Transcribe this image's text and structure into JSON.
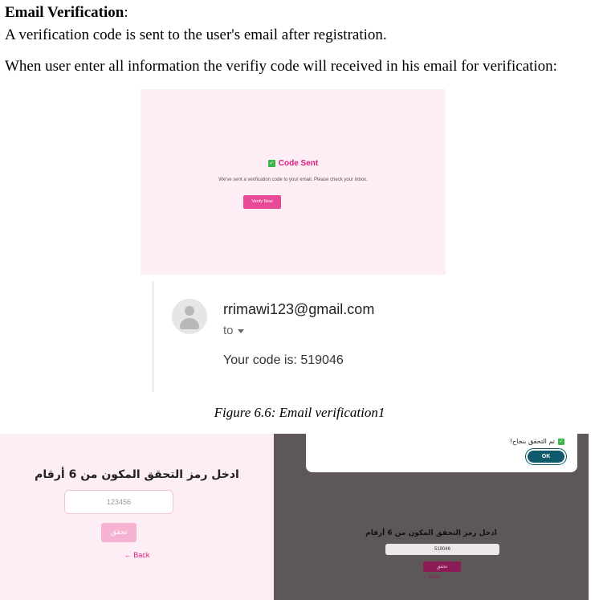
{
  "doc": {
    "heading": "Email Verification",
    "heading_suffix": ":",
    "paragraph1": "A verification code is sent to the user's email after registration.",
    "paragraph2": "When user enter all information the verifiy code will received in his email for verification:",
    "caption": "Figure 6.6: Email verification1"
  },
  "code_sent_screen": {
    "title": "Code Sent",
    "message": "We've sent a verification code to your email. Please check your inbox.",
    "button": "Verify Now",
    "icon": "check-box-icon",
    "accent": "#e0197c",
    "background": "#fdeef6"
  },
  "email_screen": {
    "sender": "rrimawi123@gmail.com",
    "to": "to",
    "body": "Your code is: 519046",
    "icon": "avatar-icon"
  },
  "enter_code_screen": {
    "title": "ادخل رمز التحقق المكون من 6 أرقام",
    "input_placeholder": "123456",
    "button": "تحقق",
    "back": "← Back"
  },
  "verified_screen": {
    "dialog_message": "تم التحقق بنجاح!",
    "ok_button": "OK",
    "title": "ادخل رمز التحقق المكون من 6 أرقام",
    "input_value": "519046",
    "button": "تحقق",
    "back": "← Back",
    "overlay": "#5e5758"
  }
}
